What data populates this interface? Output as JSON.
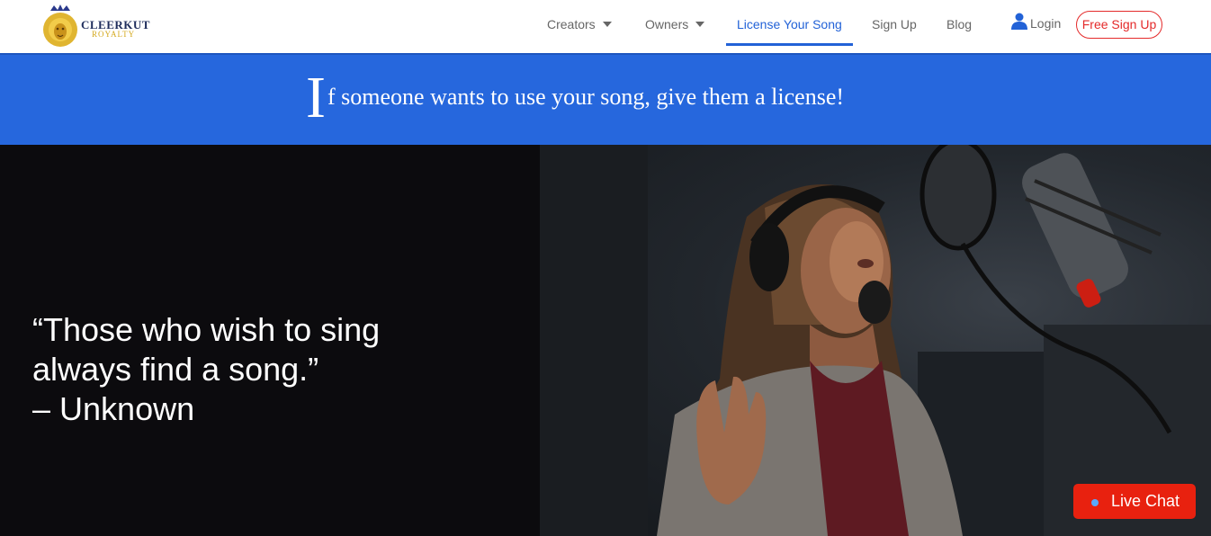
{
  "brand": {
    "line1": "CLEERKUT",
    "line2": "ROYALTY"
  },
  "nav": {
    "creators": "Creators",
    "owners": "Owners",
    "license": "License Your Song",
    "signup": "Sign Up",
    "blog": "Blog",
    "login": "Login",
    "free_signup": "Free Sign Up"
  },
  "banner": {
    "dropcap": "I",
    "text": "f someone wants to use your song, give them a license!"
  },
  "hero": {
    "quote_line1": "“Those who wish to sing",
    "quote_line2": "always find a song.”",
    "quote_author": "– Unknown"
  },
  "chat": {
    "label": "Live Chat"
  },
  "colors": {
    "accent": "#2262d7",
    "banner": "#2667dd",
    "signup": "#e42a2a",
    "chat": "#e8210f"
  }
}
